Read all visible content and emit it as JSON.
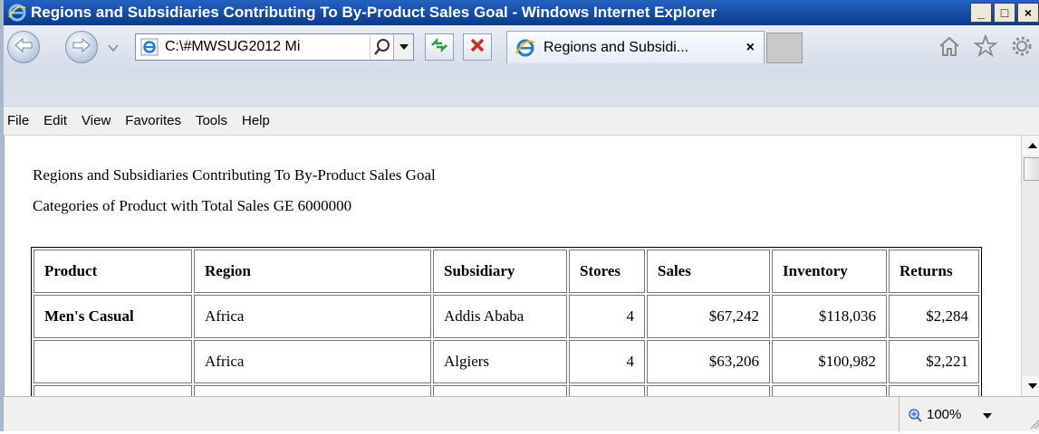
{
  "window": {
    "title": "Regions and Subsidiaries Contributing To By-Product Sales Goal - Windows Internet Explorer",
    "minimize_label": "_",
    "maximize_label": "□",
    "close_label": "×"
  },
  "navbar": {
    "address": "C:\\#MWSUG2012 Mi",
    "tab_title": "Regions and Subsidi...",
    "tab_close": "×"
  },
  "menu": {
    "items": [
      "File",
      "Edit",
      "View",
      "Favorites",
      "Tools",
      "Help"
    ]
  },
  "report": {
    "title": "Regions and Subsidiaries Contributing To By-Product Sales Goal",
    "subtitle": "Categories of Product with Total Sales GE 6000000",
    "columns": [
      "Product",
      "Region",
      "Subsidiary",
      "Stores",
      "Sales",
      "Inventory",
      "Returns"
    ],
    "rows": [
      [
        "Men's Casual",
        "Africa",
        "Addis Ababa",
        "4",
        "$67,242",
        "$118,036",
        "$2,284"
      ],
      [
        "",
        "Africa",
        "Algiers",
        "4",
        "$63,206",
        "$100,982",
        "$2,221"
      ],
      [
        "",
        "",
        "",
        "",
        "",
        "",
        ""
      ]
    ]
  },
  "status": {
    "zoom": "100%"
  },
  "icons": {
    "ie_logo": "ie-logo-icon",
    "back": "back-arrow-icon",
    "forward": "forward-arrow-icon",
    "search": "search-icon",
    "refresh": "refresh-icon",
    "stop": "stop-icon",
    "home": "home-icon",
    "favorites": "star-icon",
    "tools": "gear-icon"
  },
  "colors": {
    "titlebar": "#0b3a8a",
    "ie_blue": "#1e7ad6",
    "stop_red": "#d22b2b",
    "refresh_green": "#2e9e3a"
  }
}
